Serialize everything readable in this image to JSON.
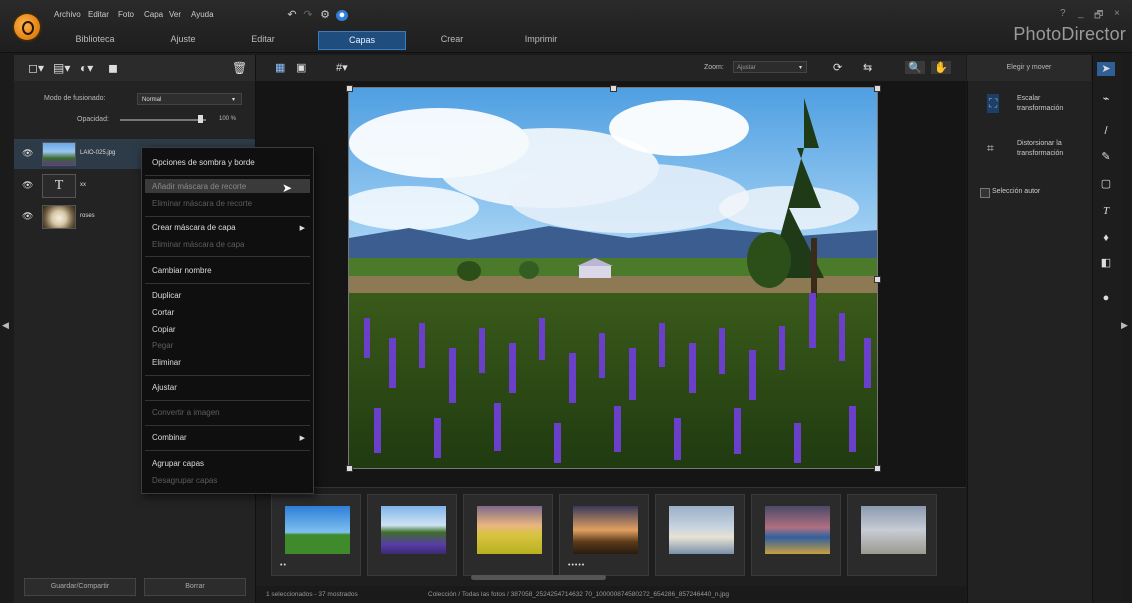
{
  "app": {
    "title": "PhotoDirector"
  },
  "menu": [
    "Archivo",
    "Editar",
    "Foto",
    "Capa",
    "Ver",
    "Ayuda"
  ],
  "tabs": [
    {
      "label": "Biblioteca",
      "active": false
    },
    {
      "label": "Ajuste",
      "active": false
    },
    {
      "label": "Editar",
      "active": false
    },
    {
      "label": "Capas",
      "active": true
    },
    {
      "label": "Crear",
      "active": false
    },
    {
      "label": "Imprimir",
      "active": false
    }
  ],
  "window_controls": {
    "help": "?",
    "minimize": "_",
    "maximize": "🗗",
    "close": "×"
  },
  "layers_panel": {
    "blend_label": "Modo de fusionado:",
    "blend_value": "Normal",
    "opacity_label": "Opacidad:",
    "opacity_value": "100 %",
    "opacity": 1.0,
    "layers": [
      {
        "name": "LAIO-025.jpg",
        "selected": true
      },
      {
        "name": "xx",
        "selected": false
      },
      {
        "name": "roses",
        "selected": false
      }
    ],
    "save_share": "Guardar/Compartir",
    "reset": "Borrar"
  },
  "context_menu": {
    "items": [
      {
        "label": "Opciones de sombra y borde",
        "disabled": false
      },
      {
        "label": "Añadir máscara de recorte",
        "disabled": true,
        "highlighted": true
      },
      {
        "label": "Eliminar máscara de recorte",
        "disabled": true
      },
      {
        "label": "Crear máscara de capa",
        "disabled": false,
        "submenu": true
      },
      {
        "label": "Eliminar máscara de capa",
        "disabled": true
      },
      {
        "label": "Cambiar nombre",
        "disabled": false
      },
      {
        "label": "Duplicar",
        "disabled": false
      },
      {
        "label": "Cortar",
        "disabled": false
      },
      {
        "label": "Copiar",
        "disabled": false
      },
      {
        "label": "Pegar",
        "disabled": true
      },
      {
        "label": "Eliminar",
        "disabled": false
      },
      {
        "label": "Ajustar",
        "disabled": false
      },
      {
        "label": "Convertir a imagen",
        "disabled": true
      },
      {
        "label": "Combinar",
        "disabled": false,
        "submenu": true
      },
      {
        "label": "Agrupar capas",
        "disabled": false
      },
      {
        "label": "Desagrupar capas",
        "disabled": true
      }
    ],
    "submenu_arrow": "▶"
  },
  "viewer": {
    "zoom_label": "Zoom:",
    "zoom_value": "Ajustar"
  },
  "filmstrip": {
    "thumbs": [
      {
        "name": "blue-sky-field",
        "dots": "••"
      },
      {
        "name": "lavender-field",
        "dots": ""
      },
      {
        "name": "yellow-field",
        "dots": ""
      },
      {
        "name": "castle-sunset",
        "dots": "•••••"
      },
      {
        "name": "coast",
        "dots": ""
      },
      {
        "name": "harbor-night",
        "dots": ""
      },
      {
        "name": "ruins",
        "dots": ""
      }
    ]
  },
  "status": {
    "selection": "1 seleccionados - 37 mostrados",
    "path": "Colección / Todas las fotos / 387058_2524254714632 70_100000874580272_654286_857246440_n.jpg"
  },
  "right_panel": {
    "header": "Elegir y mover",
    "items": [
      {
        "label": "Escalar transformación"
      },
      {
        "label": "Distorsionar la transformación"
      }
    ],
    "auto_select": "Selección autor"
  }
}
